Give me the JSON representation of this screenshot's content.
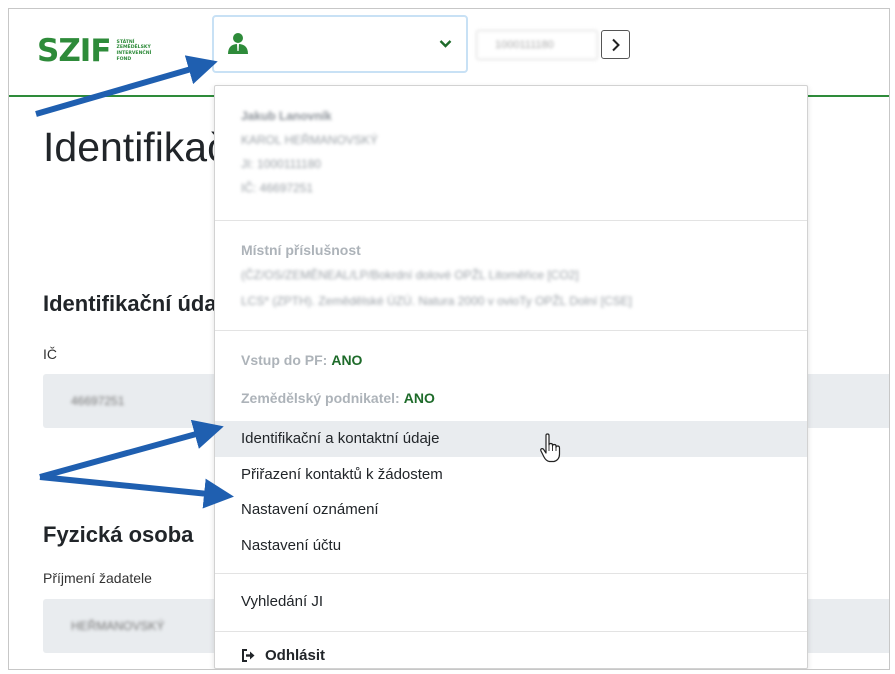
{
  "header": {
    "logo_main": "SZIF",
    "logo_sub": [
      "STÁTNÍ",
      "ZEMĚDĚLSKÝ",
      "INTERVENČNÍ",
      "FOND"
    ],
    "id_value": "1000111180"
  },
  "page": {
    "title": "Identifikační a kontaktní údaje",
    "section1_title": "Identifikační údaje",
    "ic_label": "IČ",
    "ic_value": "46697251",
    "section2_title": "Fyzická osoba",
    "surname_label": "Příjmení žadatele",
    "surname_value": "HEŘMANOVSKÝ"
  },
  "dropdown": {
    "user_block": [
      "Jakub Lanovník",
      "KAROL HEŘMANOVSKÝ",
      "JI: 1000111180",
      "IČ: 46697251"
    ],
    "locality_heading": "Místní příslušnost",
    "locality_lines": [
      "(ČZ/OS/ZEMĚNEAL/LP/Bokrdní dolové OPŽL Litoměřice [CO2]",
      "LCS* (ZPTH). Zemědělské ÚZÚ. Natura 2000 v ovioTy OPŽL Dolní [CSE]"
    ],
    "pf_label": "Vstup do PF:",
    "pf_value": "ANO",
    "farmer_label": "Zemědělský podnikatel:",
    "farmer_value": "ANO",
    "menu_items": [
      "Identifikační a kontaktní údaje",
      "Přiřazení kontaktů k žádostem",
      "Nastavení oznámení",
      "Nastavení účtu"
    ],
    "search_item": "Vyhledání JI",
    "logout_label": "Odhlásit"
  },
  "icons": {
    "user": "user-icon",
    "chevron": "chevron-down-icon",
    "go": "chevron-right-icon",
    "logout": "sign-out-icon",
    "cursor": "hand-pointer-icon"
  },
  "colors": {
    "brand_green": "#2e8b3a",
    "status_green": "#1e6b2a",
    "annotation_blue": "#1f5fb0"
  }
}
